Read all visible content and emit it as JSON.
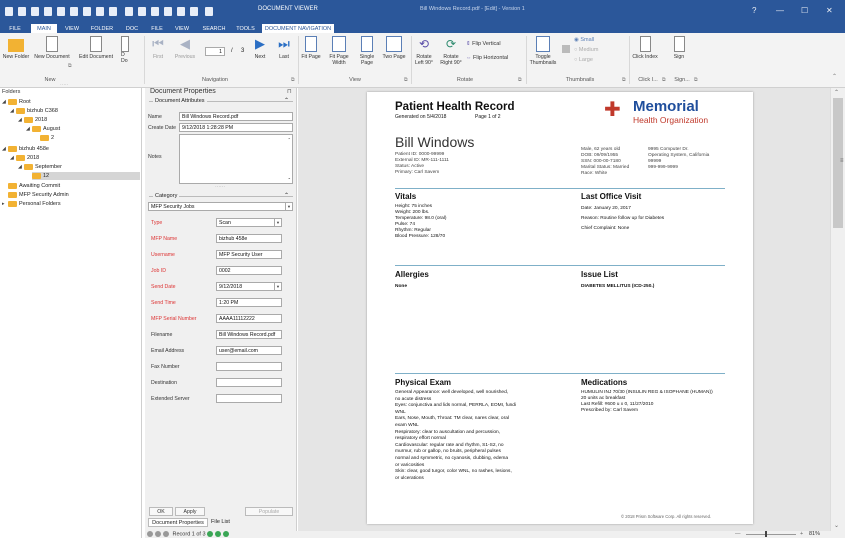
{
  "titlebar": {
    "context_tab": "DOCUMENT VIEWER",
    "window_title": "Bill Windows Record.pdf - [Edit] - Version 1"
  },
  "tabs": [
    "FILE",
    "MAIN",
    "VIEW",
    "FOLDER",
    "DOC",
    "FILE",
    "VIEW",
    "SEARCH",
    "TOOLS",
    "DOCUMENT NAVIGATION"
  ],
  "ribbon": {
    "new_folder": "New Folder",
    "new_document": "New Document",
    "edit_document": "Edit Document",
    "edit_document_cut": "D",
    "edit_document_cut2": "Do",
    "group_new": "New",
    "first_page": "First",
    "previous": "Previous",
    "page_current": "1",
    "page_sep": "/",
    "page_total": "3",
    "next": "Next",
    "last": "Last",
    "group_navigation": "Navigation",
    "fit_page": "Fit Page",
    "fit_page_width": "Fit Page Width",
    "single_page": "Single Page",
    "two_page": "Two Page",
    "group_view": "View",
    "rotate_left": "Rotate Left 90°",
    "rotate_right": "Rotate Right 90°",
    "flip_vertical": "Flip Vertical",
    "flip_horizontal": "Flip Horizontal",
    "group_rotate": "Rotate",
    "toggle_thumbnails": "Toggle Thumbnails",
    "thumb_small": "Small",
    "thumb_medium": "Medium",
    "thumb_large": "Large",
    "group_thumbnails": "Thumbnails",
    "click_index": "Click Index",
    "sign": "Sign",
    "group_click": "Click I...",
    "group_sign": "Sign..."
  },
  "tree": {
    "header": "Folders",
    "items": [
      "Root",
      "bizhub C368",
      "2018",
      "August",
      "2",
      "bizhub 458e",
      "2018",
      "September",
      "12",
      "Awaiting Commit",
      "MFP Security Admin",
      "Personal Folders"
    ]
  },
  "props": {
    "title": "Document Properties",
    "attributes_label": "Document Attributes",
    "name_label": "Name",
    "name_value": "Bill Windows Record.pdf",
    "create_label": "Create Date",
    "create_value": "9/12/2018 1:28:28 PM",
    "notes_label": "Notes",
    "category_label": "Category",
    "category_value": "MFP Security Jobs",
    "fields": [
      {
        "label": "Type",
        "value": "Scan",
        "req": true,
        "dd": true
      },
      {
        "label": "MFP Name",
        "value": "bizhub 458e",
        "req": true,
        "dd": false
      },
      {
        "label": "Username",
        "value": "MFP Security User",
        "req": true,
        "dd": false
      },
      {
        "label": "Job ID",
        "value": "0002",
        "req": true,
        "dd": false
      },
      {
        "label": "Send Date",
        "value": "9/12/2018",
        "req": true,
        "dd": true
      },
      {
        "label": "Send Time",
        "value": "1:20 PM",
        "req": true,
        "dd": false
      },
      {
        "label": "MFP Serial Number",
        "value": "AAAA11112222",
        "req": true,
        "dd": false
      },
      {
        "label": "Filename",
        "value": "Bill Windows Record.pdf",
        "req": false,
        "dd": false
      },
      {
        "label": "Email Address",
        "value": "user@email.com",
        "req": false,
        "dd": false
      },
      {
        "label": "Fax Number",
        "value": "",
        "req": false,
        "dd": false
      },
      {
        "label": "Destination",
        "value": "",
        "req": false,
        "dd": false
      },
      {
        "label": "Extended Server",
        "value": "",
        "req": false,
        "dd": false
      }
    ],
    "ok": "OK",
    "apply": "Apply",
    "populate": "Populate",
    "tab_props": "Document Properties",
    "tab_files": "File List"
  },
  "doc": {
    "title": "Patient Health Record",
    "generated": "Generated on 5/4/2018",
    "page_of": "Page 1 of 2",
    "org1": "Memorial",
    "org2": "Health Organization",
    "patient_name": "Bill Windows",
    "patient_lines": [
      "Patient ID: 0000-99999",
      "External ID: MR-111-1111",
      "Status: Active",
      "Primary: Carl Savem"
    ],
    "demo_left": [
      "Male, 62 years old",
      "DOB: 09/09/1955",
      "SSN: 000-00-7180",
      "Marital Status: Married",
      "Race: White"
    ],
    "demo_right": [
      "9995 Computer Dr.",
      "Operating System, California",
      "99999",
      "999-999-9999"
    ],
    "vitals_h": "Vitals",
    "vitals": [
      "Height: 75 inches",
      "Weight: 200 lbs.",
      "Temperature: 98.0 (oral)",
      "Pulse: 74",
      "Rhythm: Regular",
      "Blood Pressure: 128/70"
    ],
    "last_visit_h": "Last Office Visit",
    "last_visit": [
      "Date: January 20, 2017",
      "Reason: Routine follow up for Diabetes",
      "Chief Complaint: None"
    ],
    "allergies_h": "Allergies",
    "allergies": "None",
    "issues_h": "Issue List",
    "issues": "DIABETES MELLITUS (ICD-250.)",
    "exam_h": "Physical Exam",
    "exam": [
      "General Appearance: well developed, well nourished,",
      "no acute distress",
      "Eyes: conjunctiva and lids normal, PERRLA, EOMI, fundi",
      "WNL",
      "Ears, Nose, Mouth, Throat: TM clear, nares clear, oral",
      "exam WNL",
      "Respiratory: clear to auscultation and percussion,",
      "respiratory effort normal",
      "Cardiovascular: regular rate and rhythm, S1-S2, no",
      "murmur, rub or gallop, no bruits, peripheral pulses",
      "normal and symmetric, no cyanosis, clubbing, edema",
      "or varicosities",
      "Skin: clear, good turgor, color WNL, no rashes, lesions,",
      "or ulcerations"
    ],
    "meds_h": "Medications",
    "meds": [
      "HUMULIN INJ 70/30 (INSULIN REG & ISOPHANE (HUMAN))",
      "20 units ac breakfast",
      "Last Refill: #600 u x 0, 11/27/2010",
      "Prescribed by: Carl Savem"
    ],
    "footer": "© 2018 Prism Software Corp. All rights reserved."
  },
  "status": {
    "record": "Record 1 of 3",
    "zoom": "81%"
  },
  "colors": {
    "accent": "#2b579a",
    "brand": "#1f4e9c",
    "required": "#d33",
    "cross": "#c0392b"
  }
}
